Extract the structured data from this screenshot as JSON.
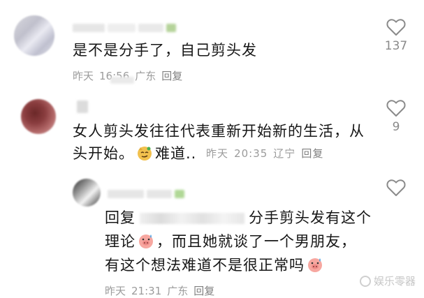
{
  "comments": [
    {
      "text": "是不是分手了，自己剪头发",
      "date": "昨天",
      "time": "16:56",
      "location": "广东",
      "reply_label": "回复",
      "likes": "137"
    },
    {
      "text_line1": "女人剪头发往往代表重新开始新的生活，从",
      "text_line2": "头开始。",
      "trailing_text": "难道..",
      "date": "昨天",
      "time": "20:35",
      "location": "辽宁",
      "reply_label": "回复",
      "likes": "9"
    },
    {
      "reply_prefix": "回复",
      "line1_after_mention": "分手剪头发有这个",
      "line2_a": "理论",
      "line2_b": "，而且她就谈了一个男朋友，",
      "line3": "有这个想法难道不是很正常吗",
      "date": "昨天",
      "time": "21:31",
      "location": "广东",
      "reply_label": "回复"
    }
  ],
  "watermark": "娱乐零器",
  "icons": {
    "like": "heart-outline-icon",
    "emoji_1": "smug-face-emoji-icon",
    "emoji_2": "pig-sweat-emoji-icon"
  },
  "colors": {
    "text": "#161616",
    "meta": "#9b9b9b",
    "like_count": "#8a8a8a"
  }
}
